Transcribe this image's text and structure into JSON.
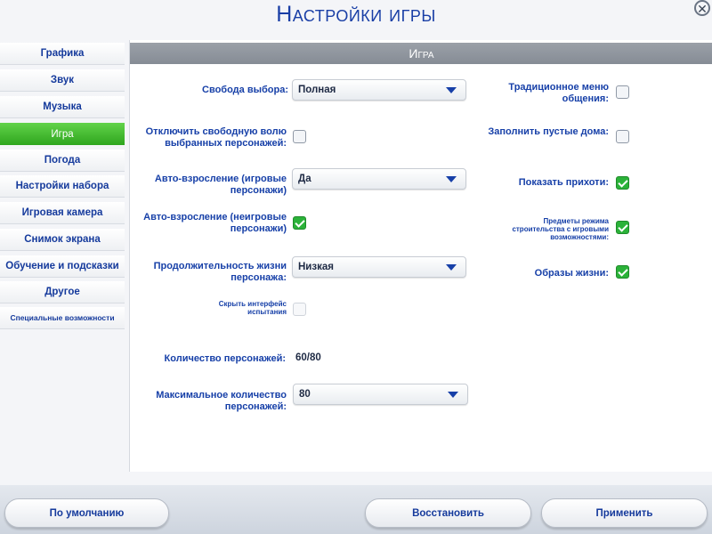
{
  "window": {
    "title": "Настройки игры",
    "close_symbol": "✕"
  },
  "sidebar": {
    "items": [
      {
        "label": "Графика"
      },
      {
        "label": "Звук"
      },
      {
        "label": "Музыка"
      },
      {
        "label": "Игра",
        "active": true
      },
      {
        "label": "Погода"
      },
      {
        "label": "Настройки набора"
      },
      {
        "label": "Игровая камера"
      },
      {
        "label": "Снимок экрана"
      },
      {
        "label": "Обучение и подсказки"
      },
      {
        "label": "Другое"
      },
      {
        "label": "Специальные возможности"
      }
    ]
  },
  "panel": {
    "title": "Игра",
    "left": {
      "free_will": {
        "label": "Свобода выбора:",
        "value": "Полная"
      },
      "disable_free_will": {
        "label": "Отключить свободную волю выбранных персонажей:",
        "checked": false
      },
      "auto_age_played": {
        "label": "Авто-взросление (игровые персонажи)",
        "value": "Да"
      },
      "auto_age_unplayed": {
        "label": "Авто-взросление (неигровые персонажи)",
        "checked": true
      },
      "lifespan": {
        "label": "Продолжительность жизни персонажа:",
        "value": "Низкая"
      },
      "hide_trial_ui": {
        "label": "Скрыть интерфейс испытания",
        "checked": false
      },
      "sim_count": {
        "label": "Количество персонажей:",
        "value": "60/80"
      },
      "max_sims": {
        "label": "Максимальное количество персонажей:",
        "value": "80"
      }
    },
    "right": {
      "classic_menu": {
        "label": "Традиционное меню общения:",
        "checked": false
      },
      "fill_empty_homes": {
        "label": "Заполнить пустые дома:",
        "checked": false
      },
      "show_whims": {
        "label": "Показать прихоти:",
        "checked": true
      },
      "build_mode_items": {
        "label": "Предметы режима строительства с игровыми возможностями:",
        "checked": true
      },
      "lifestyles": {
        "label": "Образы жизни:",
        "checked": true
      }
    }
  },
  "footer": {
    "defaults_label": "По умолчанию",
    "restore_label": "Восстановить",
    "apply_label": "Применить"
  },
  "colors": {
    "accent": "#1740a8",
    "active_tab": "#3cb82c",
    "check_on": "#2bb239"
  }
}
